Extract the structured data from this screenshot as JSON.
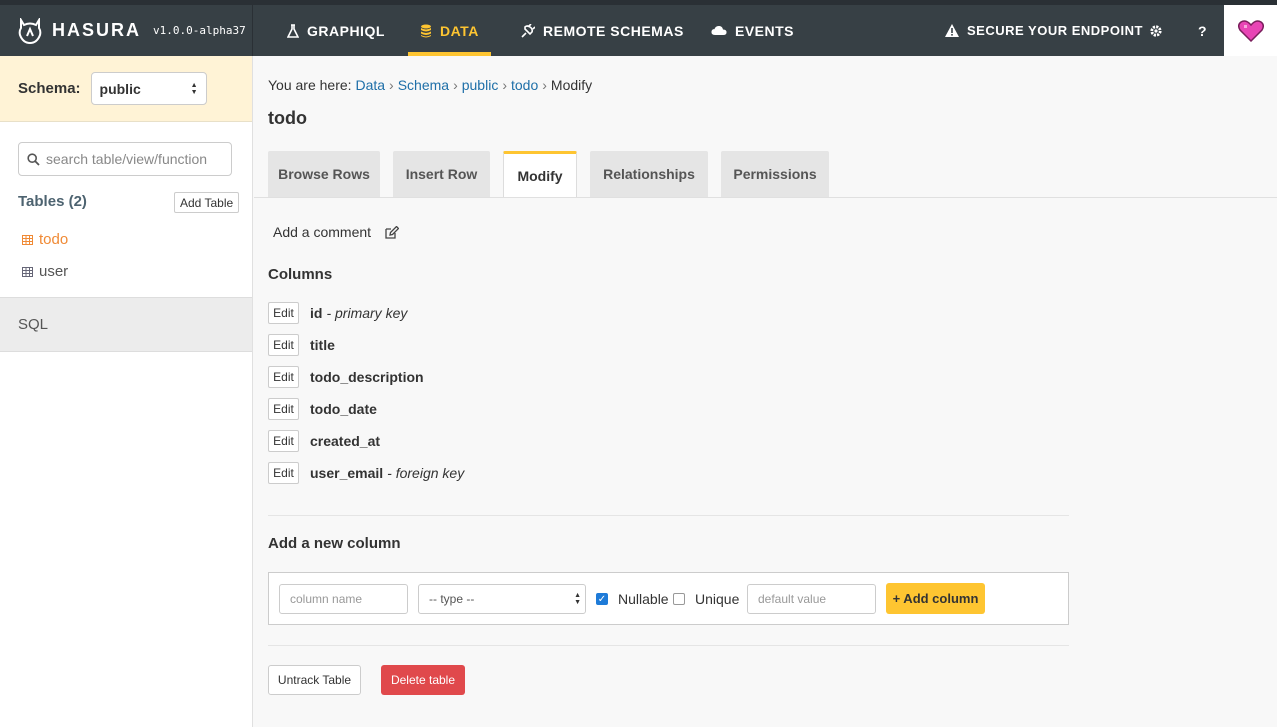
{
  "app": {
    "brand_name": "HASURA",
    "version": "v1.0.0-alpha37"
  },
  "nav": {
    "items": [
      {
        "label": "GRAPHIQL",
        "icon": "flask-icon"
      },
      {
        "label": "DATA",
        "icon": "database-icon",
        "active": true
      },
      {
        "label": "REMOTE SCHEMAS",
        "icon": "plug-icon"
      },
      {
        "label": "EVENTS",
        "icon": "cloud-icon"
      }
    ],
    "secure_label": "SECURE YOUR ENDPOINT",
    "settings_icon": "gear-icon",
    "help_label": "?",
    "heart_icon": "heart-icon"
  },
  "colors": {
    "topbar": "#374045",
    "accent": "#fec531",
    "link": "#1e6fa8",
    "sidebar_table_active": "#f08a35",
    "danger": "#e0494c",
    "heart": "#e845b5"
  },
  "sidebar": {
    "schema_label": "Schema:",
    "schema_value": "public",
    "search_placeholder": "search table/view/function",
    "tables_heading": "Tables (2)",
    "add_table_label": "Add Table",
    "tables": [
      {
        "name": "todo",
        "active": true
      },
      {
        "name": "user",
        "active": false
      }
    ],
    "sql_label": "SQL"
  },
  "breadcrumb": {
    "prefix": "You are here:",
    "links": [
      "Data",
      "Schema",
      "public",
      "todo"
    ],
    "current": "Modify"
  },
  "page_title": "todo",
  "tabs": [
    {
      "label": "Browse Rows"
    },
    {
      "label": "Insert Row"
    },
    {
      "label": "Modify",
      "active": true
    },
    {
      "label": "Relationships"
    },
    {
      "label": "Permissions"
    }
  ],
  "comment": {
    "label": "Add a comment"
  },
  "columns": {
    "heading": "Columns",
    "edit_label": "Edit",
    "rows": [
      {
        "name": "id",
        "note": "- primary key"
      },
      {
        "name": "title",
        "note": ""
      },
      {
        "name": "todo_description",
        "note": ""
      },
      {
        "name": "todo_date",
        "note": ""
      },
      {
        "name": "created_at",
        "note": ""
      },
      {
        "name": "user_email",
        "note": "- foreign key"
      }
    ]
  },
  "new_column": {
    "heading": "Add a new column",
    "name_placeholder": "column name",
    "type_value": "-- type --",
    "nullable_label": "Nullable",
    "nullable_checked": true,
    "unique_label": "Unique",
    "unique_checked": false,
    "default_placeholder": "default value",
    "add_button_label": "+ Add column"
  },
  "actions": {
    "untrack_label": "Untrack Table",
    "delete_label": "Delete table"
  }
}
